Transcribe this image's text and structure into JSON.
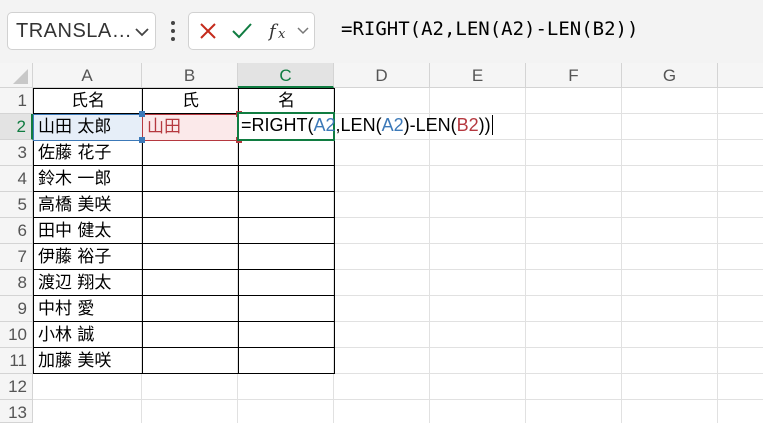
{
  "name_box": {
    "value": "TRANSLA…"
  },
  "formula_bar": {
    "formula": "=RIGHT(A2,LEN(A2)-LEN(B2))"
  },
  "columns": [
    "A",
    "B",
    "C",
    "D",
    "E",
    "F",
    "G"
  ],
  "rows": [
    "1",
    "2",
    "3",
    "4",
    "5",
    "6",
    "7",
    "8",
    "9",
    "10",
    "11",
    "12",
    "13"
  ],
  "table": {
    "headers": [
      "氏名",
      "氏",
      "名"
    ],
    "names": [
      "山田 太郎",
      "佐藤 花子",
      "鈴木 一郎",
      "高橋 美咲",
      "田中 健太",
      "伊藤 裕子",
      "渡辺 翔太",
      "中村 愛",
      "小林 誠",
      "加藤 美咲"
    ],
    "b2": "山田"
  },
  "editing": {
    "p1": "=RIGHT(",
    "p2": "A2",
    "p3": ",LEN(",
    "p4": "A2",
    "p5": ")-LEN(",
    "p6": "B2",
    "p7": "))"
  },
  "colors": {
    "accent_green": "#107c41",
    "ref_blue": "#3c79b8",
    "ref_red": "#b5383f"
  }
}
